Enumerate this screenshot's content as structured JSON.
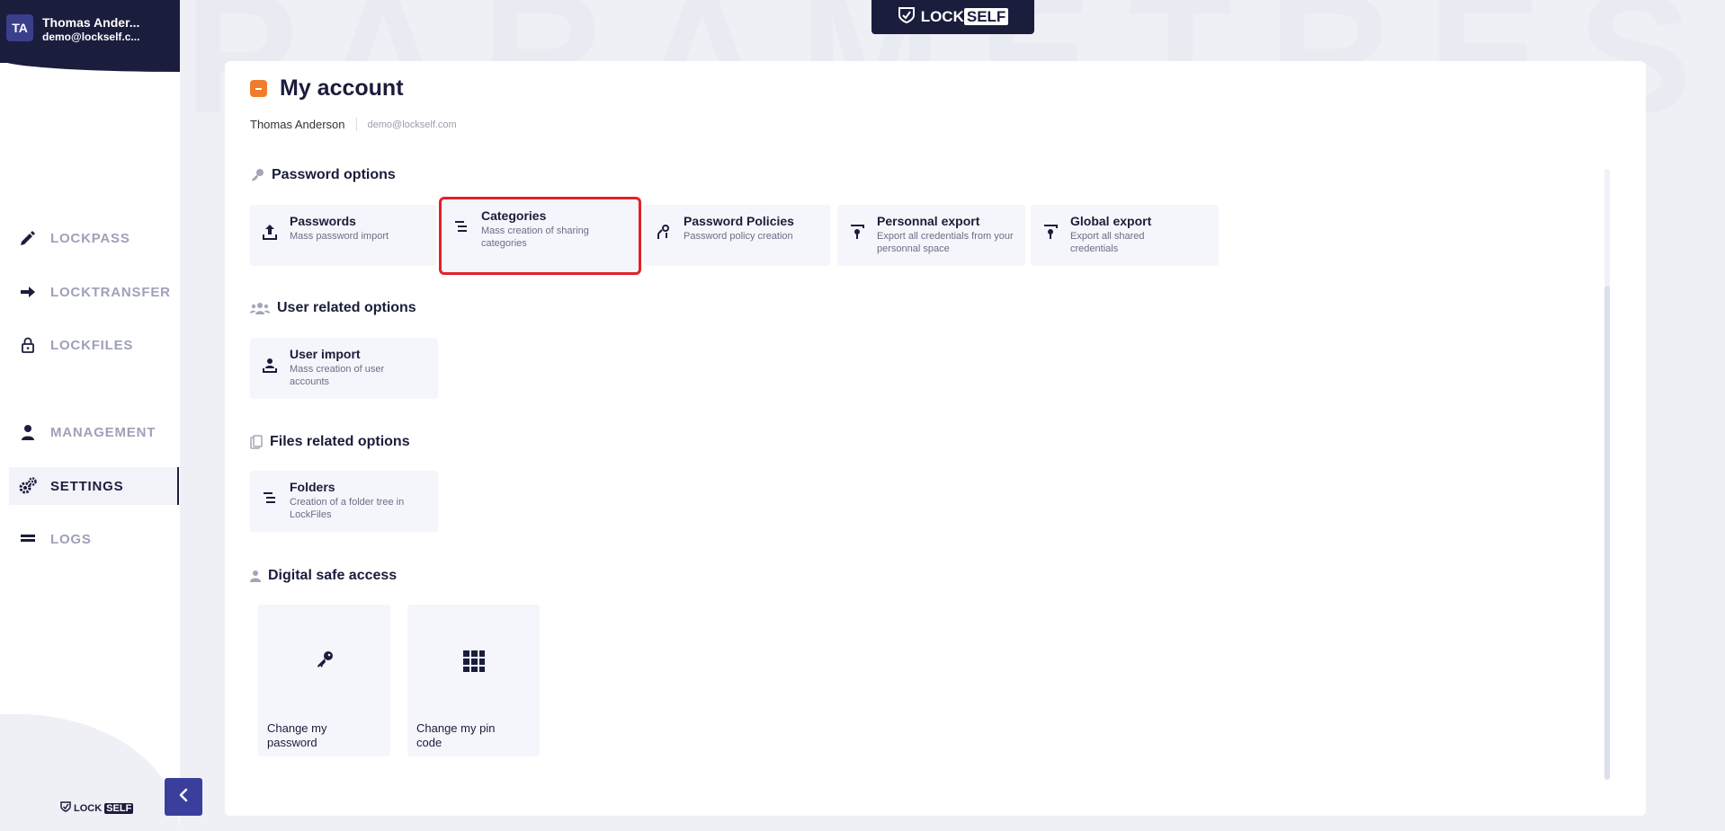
{
  "user": {
    "initials": "TA",
    "name": "Thomas Ander...",
    "email": "demo@lockself.c..."
  },
  "watermark": "PARAMETRES",
  "brand": {
    "lock": "LOCK",
    "self": "SELF"
  },
  "sidebar": {
    "items": [
      {
        "label": "LOCKPASS",
        "icon": "pen-icon"
      },
      {
        "label": "LOCKTRANSFER",
        "icon": "arrow-right-icon"
      },
      {
        "label": "LOCKFILES",
        "icon": "lock-icon"
      },
      {
        "label": "MANAGEMENT",
        "icon": "user-icon"
      },
      {
        "label": "SETTINGS",
        "icon": "gears-icon",
        "active": true
      },
      {
        "label": "LOGS",
        "icon": "bars-icon"
      }
    ]
  },
  "page": {
    "title": "My account",
    "user_name": "Thomas Anderson",
    "user_email": "demo@lockself.com"
  },
  "sections": {
    "password": {
      "title": "Password options",
      "options": [
        {
          "label": "Passwords",
          "desc": "Mass password import"
        },
        {
          "label": "Categories",
          "desc": "Mass creation of sharing categories"
        },
        {
          "label": "Password Policies",
          "desc": "Password policy creation"
        },
        {
          "label": "Personnal export",
          "desc": "Export all credentials from your personnal space"
        },
        {
          "label": "Global export",
          "desc": "Export all shared credentials"
        }
      ]
    },
    "user": {
      "title": "User related options",
      "options": [
        {
          "label": "User import",
          "desc": "Mass creation of user accounts"
        }
      ]
    },
    "files": {
      "title": "Files related options",
      "options": [
        {
          "label": "Folders",
          "desc": "Creation of a folder tree in LockFiles"
        }
      ]
    },
    "safe": {
      "title": "Digital safe access",
      "cards": [
        {
          "label": "Change my password"
        },
        {
          "label": "Change my pin code"
        }
      ]
    }
  },
  "colors": {
    "navy": "#1b1d3d",
    "accent_orange": "#f07d2b",
    "highlight_red": "#e2212b",
    "collapse_blue": "#3a3f9e"
  }
}
